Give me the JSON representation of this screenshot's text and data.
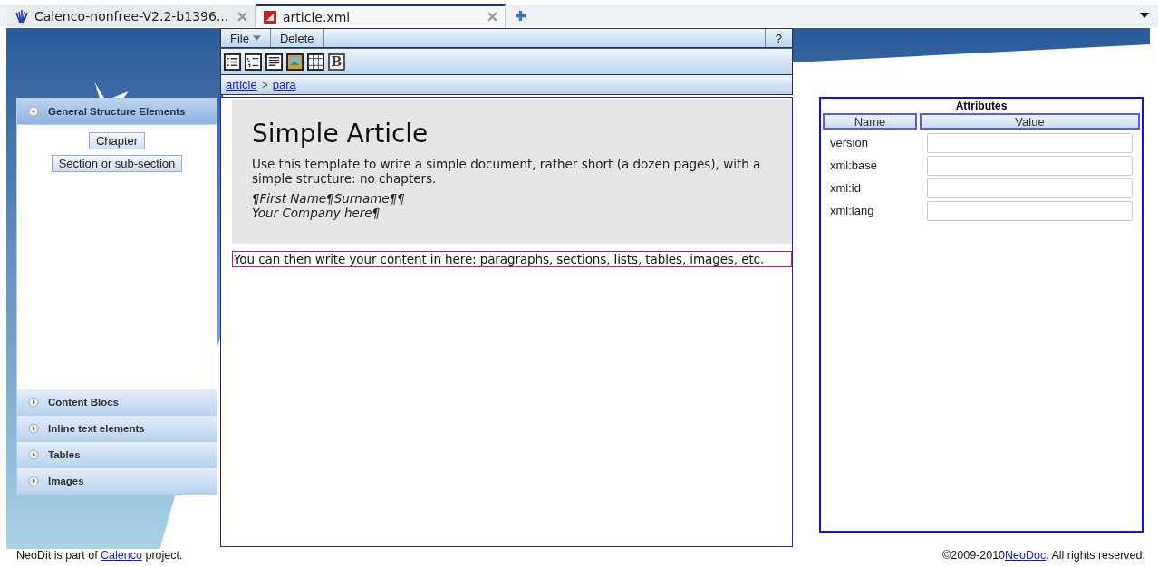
{
  "tabs": [
    {
      "label": "Calenco-nonfree-V2.2-b1396...",
      "kind": "project",
      "selected": false
    },
    {
      "label": "article.xml",
      "kind": "xml",
      "selected": true
    }
  ],
  "toolbar": {
    "menu": "File",
    "buttons": [
      "Delete"
    ],
    "help": "?"
  },
  "format_buttons": [
    {
      "kind": "itemized-list"
    },
    {
      "kind": "numbered-list"
    },
    {
      "kind": "paragraph"
    },
    {
      "kind": "image"
    },
    {
      "kind": "table"
    },
    {
      "kind": "bold",
      "label": "B"
    }
  ],
  "breadcrumb": {
    "items": [
      "article",
      "para"
    ],
    "separator": ">"
  },
  "sidebar": {
    "sections": [
      {
        "label": "General Structure Elements",
        "expanded": true,
        "buttons": [
          "Chapter",
          "Section or sub-section"
        ]
      },
      {
        "label": "Content Blocs",
        "expanded": false
      },
      {
        "label": "Inline text elements",
        "expanded": false
      },
      {
        "label": "Tables",
        "expanded": false
      },
      {
        "label": "Images",
        "expanded": false
      }
    ]
  },
  "document": {
    "title": "Simple Article",
    "abstract": "Use this template to write a simple document, rather short (a dozen pages), with a simple structure: no chapters.",
    "author": "¶First Name¶Surname¶¶",
    "company": "Your Company here¶",
    "paragraph": "You can then write your content in here: paragraphs, sections, lists, tables, images, etc."
  },
  "attributes": {
    "title": "Attributes",
    "columns": [
      "Name",
      "Value"
    ],
    "rows": [
      {
        "name": "version"
      },
      {
        "name": "xml:base"
      },
      {
        "name": "xml:id"
      },
      {
        "name": "xml:lang"
      }
    ]
  },
  "footer": {
    "left": {
      "before": "NeoDit is part of",
      "link": "Calenco",
      "after": "project."
    },
    "right": {
      "before": "©2009-2010",
      "link": "NeoDoc",
      "after": ". All rights reserved."
    }
  }
}
